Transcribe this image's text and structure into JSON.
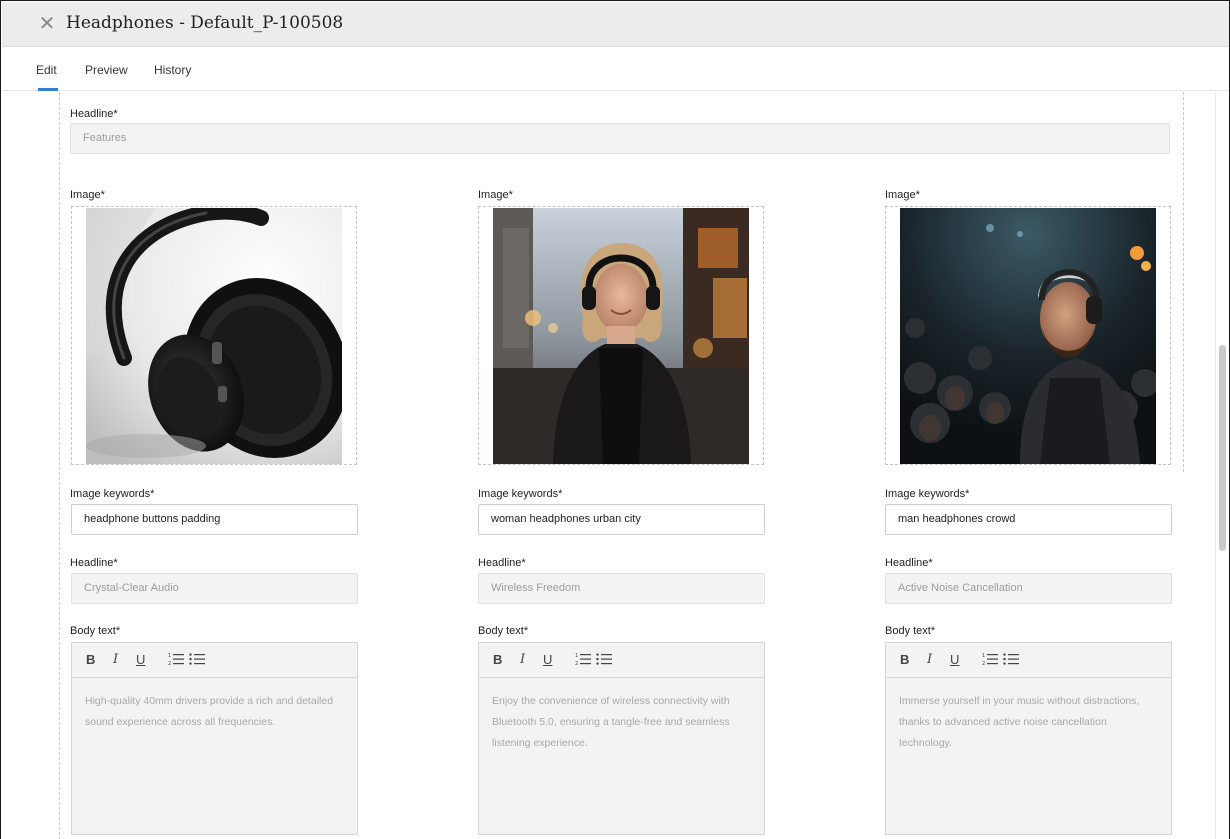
{
  "window": {
    "title": "Headphones - Default_P-100508",
    "close_icon": "close-icon"
  },
  "tabs": [
    {
      "label": "Edit",
      "active": true
    },
    {
      "label": "Preview",
      "active": false
    },
    {
      "label": "History",
      "active": false
    }
  ],
  "section": {
    "headline_label": "Headline*",
    "headline_value": "Features"
  },
  "toolbar": {
    "bold": "B",
    "italic": "I",
    "underline": "U"
  },
  "columns": [
    {
      "image_label": "Image*",
      "image_desc": "black over-ear headphones on white background",
      "keywords_label": "Image keywords*",
      "keywords_value": "headphone buttons padding",
      "headline_label": "Headline*",
      "headline_placeholder": "Crystal-Clear Audio",
      "body_label": "Body text*",
      "body_placeholder": "High-quality 40mm drivers provide a rich and detailed sound experience across all frequencies."
    },
    {
      "image_label": "Image*",
      "image_desc": "woman wearing headphones on an urban city street",
      "keywords_label": "Image keywords*",
      "keywords_value": "woman headphones urban city",
      "headline_label": "Headline*",
      "headline_placeholder": "Wireless Freedom",
      "body_label": "Body text*",
      "body_placeholder": "Enjoy the convenience of wireless connectivity with Bluetooth 5.0, ensuring a tangle-free and seamless listening experience."
    },
    {
      "image_label": "Image*",
      "image_desc": "man wearing headphones in a crowd",
      "keywords_label": "Image keywords*",
      "keywords_value": "man headphones crowd",
      "headline_label": "Headline*",
      "headline_placeholder": "Active Noise Cancellation",
      "body_label": "Body text*",
      "body_placeholder": "Immerse yourself in your music without distractions, thanks to advanced active noise cancellation technology."
    }
  ],
  "colors": {
    "accent": "#2d7fd0",
    "titlebar": "#ececec",
    "disabled_field": "#f3f3f3"
  }
}
